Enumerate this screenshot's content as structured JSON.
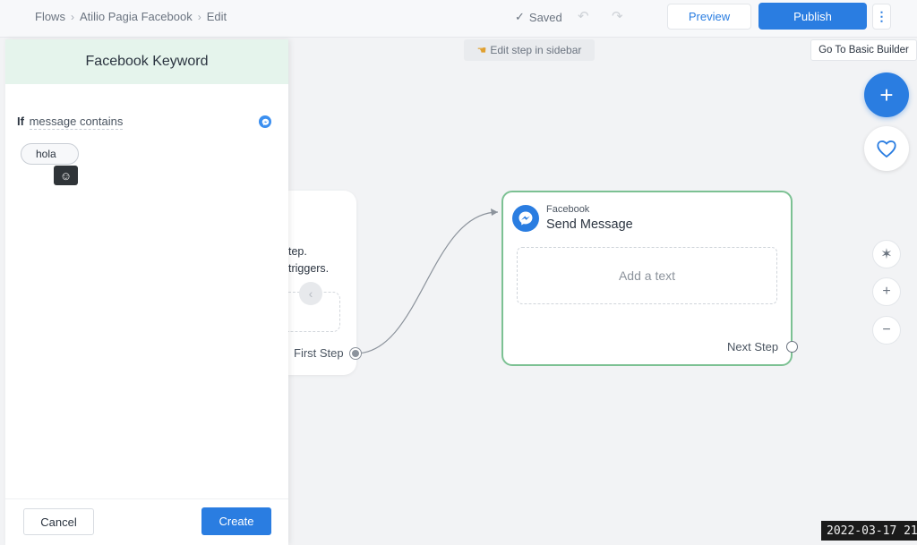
{
  "breadcrumb": {
    "items": [
      "Flows",
      "Atilio Pagia Facebook",
      "Edit"
    ]
  },
  "toolbar": {
    "saved_label": "Saved",
    "preview_label": "Preview",
    "publish_label": "Publish",
    "more_label": "⋮"
  },
  "canvas": {
    "hint": "Edit step in sidebar",
    "basic_builder_label": "Go To Basic Builder"
  },
  "panel": {
    "title": "Facebook Keyword",
    "condition_if": "If",
    "condition_field": "message contains",
    "keyword_value": "hola",
    "cancel_label": "Cancel",
    "create_label": "Create"
  },
  "trigger_card": {
    "text_line1": "tep.",
    "text_line2": "triggers.",
    "first_step_label": "First Step"
  },
  "message_card": {
    "platform": "Facebook",
    "title": "Send Message",
    "add_text_placeholder": "Add a text",
    "next_step_label": "Next Step"
  },
  "controls": {
    "add_label": "+",
    "zoom_in_label": "+",
    "zoom_out_label": "−"
  },
  "timestamp": "2022-03-17 21",
  "colors": {
    "accent": "#2a7de1",
    "card_border": "#7cc193",
    "panel_header_bg": "#e5f4ec"
  }
}
